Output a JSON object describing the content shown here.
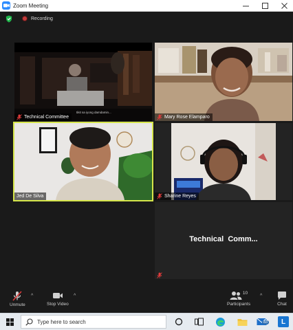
{
  "window": {
    "title": "Zoom Meeting"
  },
  "topbar": {
    "recording_label": "Recording"
  },
  "tiles": [
    {
      "name": "Technical Committee",
      "subtitle": "tikit sa iyong damdamin..."
    },
    {
      "name": "Mary Rose Elamparo"
    },
    {
      "name": "Jed De Silva"
    },
    {
      "name": "Sharine Reyes"
    },
    {
      "name": "",
      "display_name": "Technical  Comm..."
    }
  ],
  "toolbar": {
    "unmute_label": "Unmute",
    "stop_video_label": "Stop Video",
    "participants_label": "Participants",
    "participants_count": "10",
    "chat_label": "Chat"
  },
  "taskbar": {
    "search_placeholder": "Type here to search",
    "mail_badge": "83"
  },
  "colors": {
    "active_speaker_border": "#d6e64a",
    "zoom_blue": "#2d8cff",
    "muted_red": "#e03b3b",
    "recording_red": "#c23b3b"
  }
}
